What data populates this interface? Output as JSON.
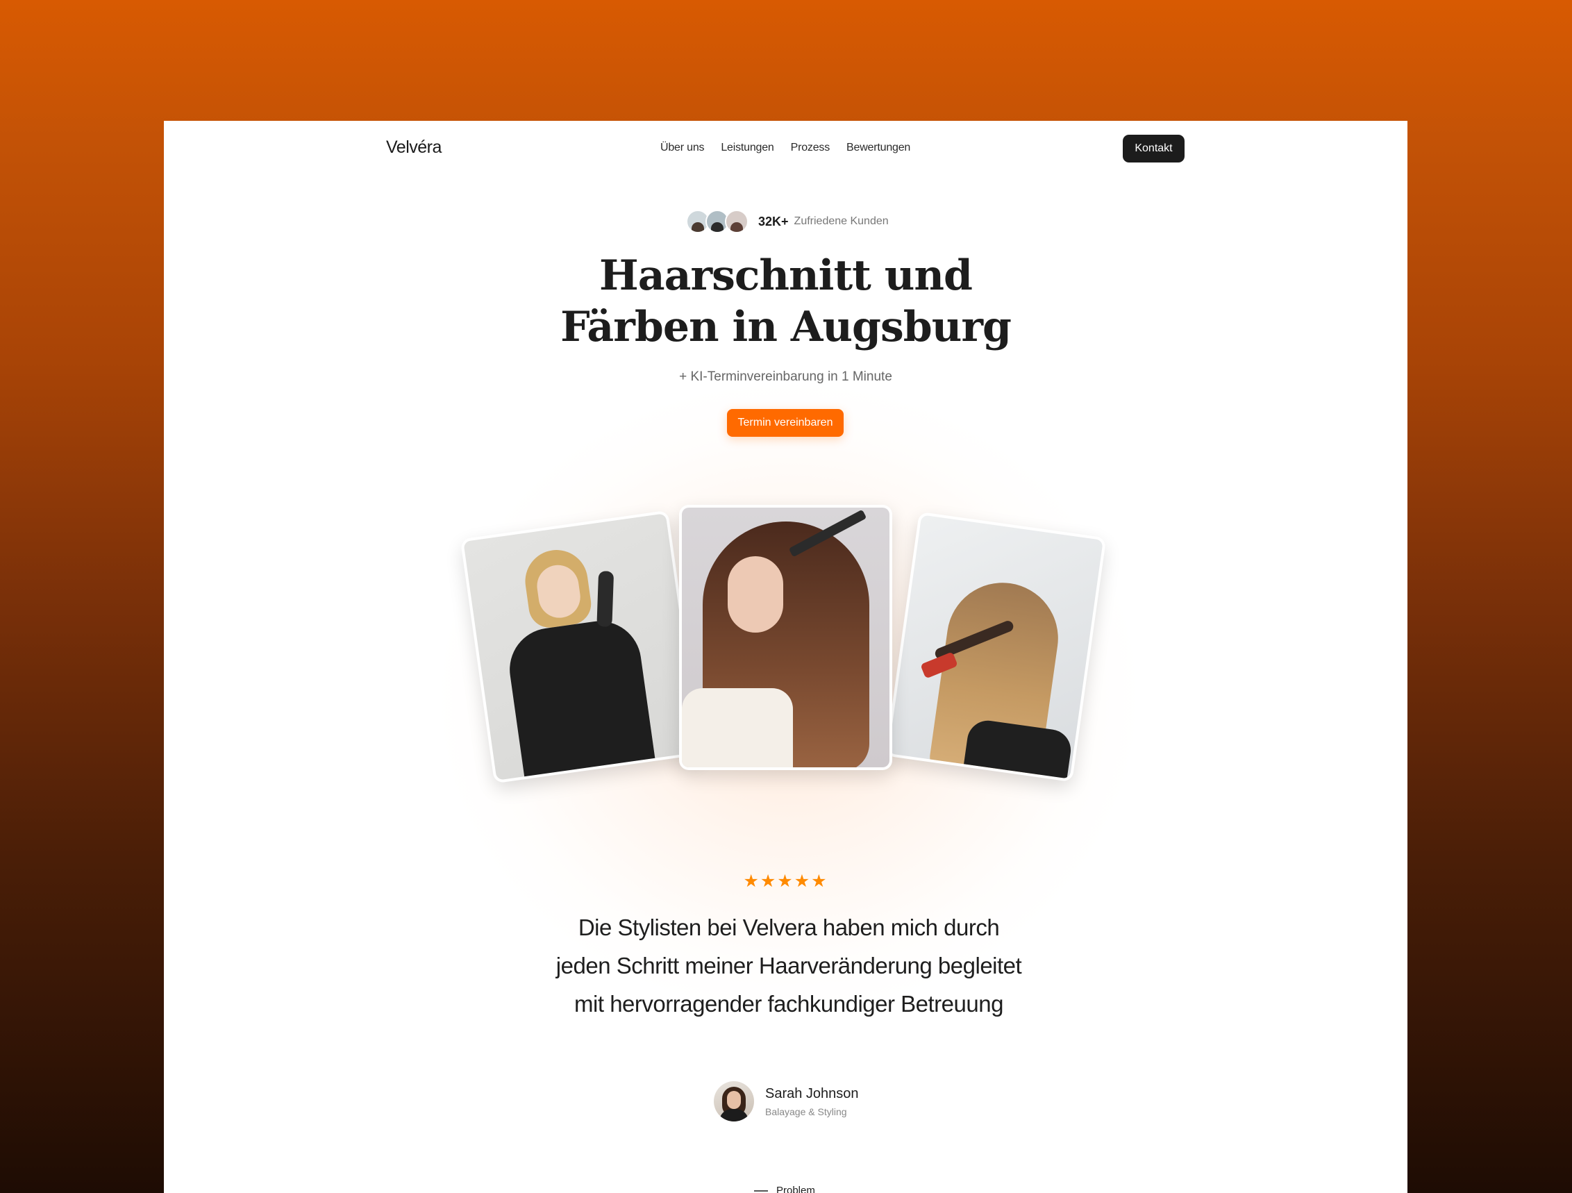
{
  "nav": {
    "brand": "Velvéra",
    "links": [
      "Über uns",
      "Leistungen",
      "Prozess",
      "Bewertungen"
    ],
    "cta": "Kontakt"
  },
  "hero": {
    "customer_count": "32K+",
    "customer_label": "Zufriedene Kunden",
    "headline_line1": "Haarschnitt und",
    "headline_line2": "Färben in Augsburg",
    "subline": "+ KI-Terminvereinbarung in 1 Minute",
    "cta": "Termin vereinbaren"
  },
  "testimonial": {
    "rating": 5,
    "stars": "★★★★★",
    "quote": "Die Stylisten bei Velvera haben mich durch jeden Schritt meiner Haarveränderung begleitet mit hervorragender fachkundiger Betreuung",
    "author_name": "Sarah Johnson",
    "author_role": "Balayage & Styling"
  },
  "next_section": {
    "tag": "Problem"
  },
  "colors": {
    "accent": "#ff6a00",
    "star": "#ff8a00",
    "dark_button": "#1c1c1c",
    "background_top": "#d85a02",
    "background_bottom": "#1e0c04"
  }
}
